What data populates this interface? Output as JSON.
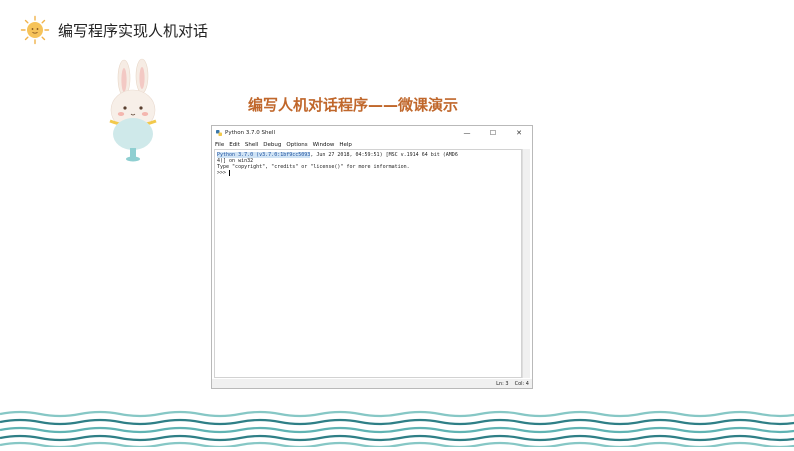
{
  "header": {
    "title": "编写程序实现人机对话"
  },
  "slide": {
    "title": "编写人机对话程序——微课演示"
  },
  "shell": {
    "title": "Python 3.7.0 Shell",
    "window_buttons": {
      "minimize": "—",
      "maximize": "☐",
      "close": "✕"
    },
    "menu": [
      "File",
      "Edit",
      "Shell",
      "Debug",
      "Options",
      "Window",
      "Help"
    ],
    "lines": {
      "line1_selected": "Python 3.7.0 (v3.7.0:1bf9cc5093",
      "line1_rest": ", Jun 27 2018, 04:59:51) [MSC v.1914 64 bit (AMD6",
      "line2": "4)] on win32",
      "line3": "Type \"copyright\", \"credits\" or \"license()\" for more information.",
      "prompt": ">>> "
    },
    "status": {
      "ln": "Ln: 3",
      "col": "Col: 4"
    }
  },
  "colors": {
    "accent": "#c0672b",
    "wave_teal": "#5fb3b3",
    "wave_dark": "#2f7f86"
  }
}
